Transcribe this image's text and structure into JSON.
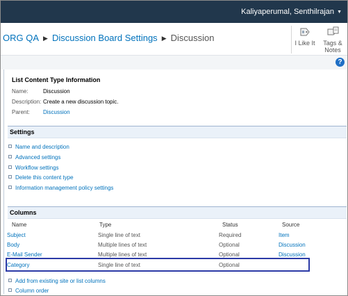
{
  "header": {
    "user_name": "Kaliyaperumal, Senthilrajan",
    "user_caret": "▼"
  },
  "breadcrumb": {
    "site": "ORG QA",
    "parent": "Discussion Board Settings",
    "current": "Discussion"
  },
  "toolbar": {
    "like_label": "I Like It",
    "tags_label": "Tags &",
    "tags_label2": "Notes"
  },
  "help": {
    "symbol": "?"
  },
  "info": {
    "title": "List Content Type Information",
    "name_label": "Name:",
    "name_value": "Discussion",
    "description_label": "Description:",
    "description_value": "Create a new discussion topic.",
    "parent_label": "Parent:",
    "parent_value": "Discussion"
  },
  "settings": {
    "title": "Settings",
    "links": [
      "Name and description",
      "Advanced settings",
      "Workflow settings",
      "Delete this content type",
      "Information management policy settings"
    ]
  },
  "columns": {
    "title": "Columns",
    "headers": {
      "name": "Name",
      "type": "Type",
      "status": "Status",
      "source": "Source"
    },
    "rows": [
      {
        "name": "Subject",
        "type": "Single line of text",
        "status": "Required",
        "source": "Item"
      },
      {
        "name": "Body",
        "type": "Multiple lines of text",
        "status": "Optional",
        "source": "Discussion"
      },
      {
        "name": "E-Mail Sender",
        "type": "Multiple lines of text",
        "status": "Optional",
        "source": "Discussion"
      },
      {
        "name": "Category",
        "type": "Single line of text",
        "status": "Optional",
        "source": ""
      }
    ],
    "add_link": "Add from existing site or list columns",
    "order_link": "Column order"
  }
}
